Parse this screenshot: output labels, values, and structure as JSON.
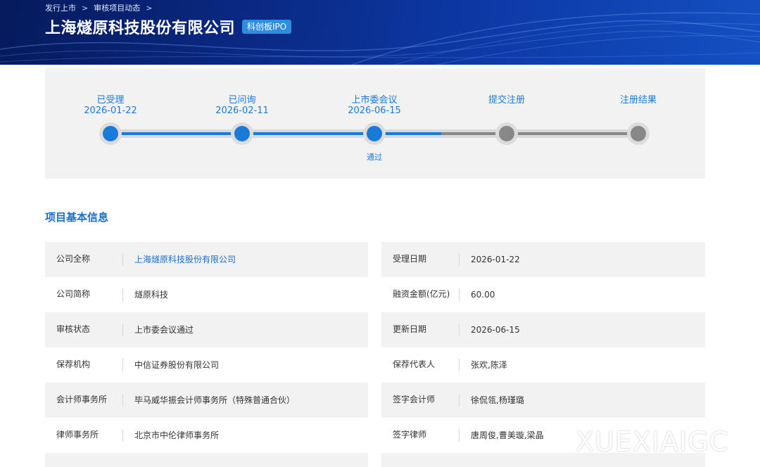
{
  "breadcrumb": [
    "发行上市",
    "审核项目动态"
  ],
  "company_title": "上海燧原科技股份有限公司",
  "board_badge": "科创板IPO",
  "progress": {
    "steps": [
      {
        "label": "已受理",
        "date": "2026-01-22",
        "note": "",
        "done": true
      },
      {
        "label": "已问询",
        "date": "2026-02-11",
        "note": "",
        "done": true
      },
      {
        "label": "上市委会议",
        "date": "2026-06-15",
        "note": "通过",
        "done": true
      },
      {
        "label": "提交注册",
        "date": "",
        "note": "",
        "done": false
      },
      {
        "label": "注册结果",
        "date": "",
        "note": "",
        "done": false
      }
    ],
    "completed_fraction": 0.5
  },
  "section_title": "项目基本信息",
  "info_left": [
    {
      "key": "公司全称",
      "value": "上海燧原科技股份有限公司",
      "link": true
    },
    {
      "key": "公司简称",
      "value": "燧原科技"
    },
    {
      "key": "审核状态",
      "value": "上市委会议通过"
    },
    {
      "key": "保荐机构",
      "value": "中信证券股份有限公司"
    },
    {
      "key": "会计师事务所",
      "value": "毕马威华振会计师事务所（特殊普通合伙）"
    },
    {
      "key": "律师事务所",
      "value": "北京市中伦律师事务所"
    }
  ],
  "info_right": [
    {
      "key": "受理日期",
      "value": "2026-01-22"
    },
    {
      "key": "融资金额(亿元)",
      "value": "60.00"
    },
    {
      "key": "更新日期",
      "value": "2026-06-15"
    },
    {
      "key": "保荐代表人",
      "value": "张欢,陈泽"
    },
    {
      "key": "签字会计师",
      "value": "徐侃瓴,杨瑾璐"
    },
    {
      "key": "签字律师",
      "value": "唐周俊,曹美璇,梁晶"
    }
  ],
  "watermark": "XUEXIAIGC",
  "colors": {
    "accent": "#1a7ad9",
    "banner": "#0a2a86",
    "pending": "#888888"
  }
}
